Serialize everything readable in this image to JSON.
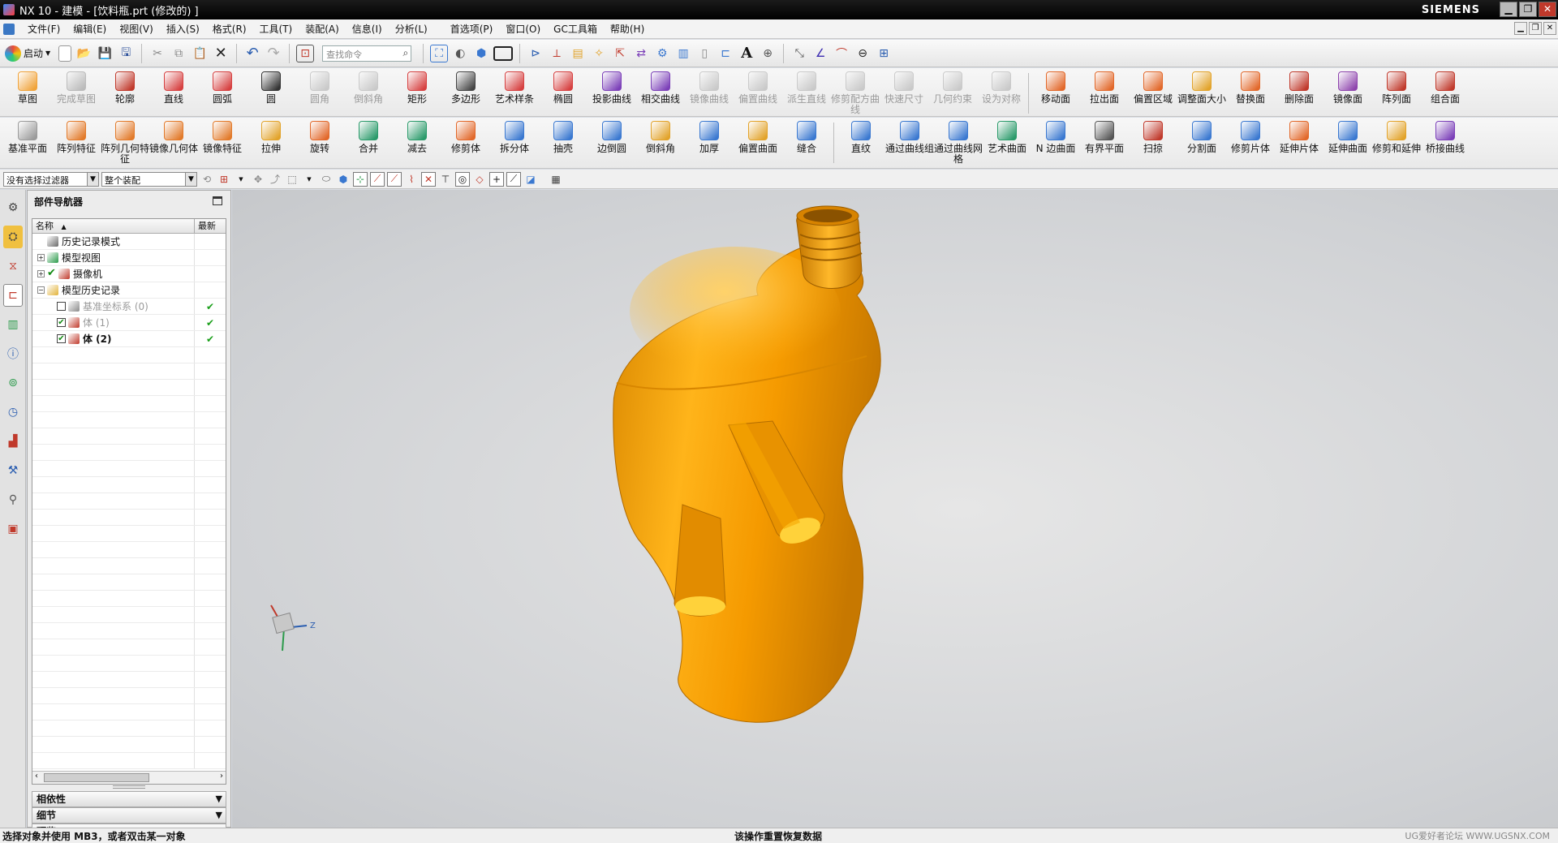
{
  "window": {
    "title": "NX 10 - 建模 - [饮料瓶.prt  (修改的) ]",
    "brand": "SIEMENS",
    "buttons": {
      "minimize": "▁",
      "restore": "❐",
      "close": "✕"
    }
  },
  "menu": [
    "文件(F)",
    "编辑(E)",
    "视图(V)",
    "插入(S)",
    "格式(R)",
    "工具(T)",
    "装配(A)",
    "信息(I)",
    "分析(L)",
    "首选项(P)",
    "窗口(O)",
    "GC工具箱",
    "帮助(H)"
  ],
  "toolbar": {
    "start_label": "启动",
    "search_placeholder": "查找命令"
  },
  "ribbon1": [
    {
      "label": "草图",
      "color": "#f0a33a",
      "disabled": false
    },
    {
      "label": "完成草图",
      "color": "#7a7a7a",
      "disabled": true
    },
    {
      "label": "轮廓",
      "color": "#c0392b",
      "disabled": false
    },
    {
      "label": "直线",
      "color": "#d64040",
      "disabled": false
    },
    {
      "label": "圆弧",
      "color": "#d64040",
      "disabled": false
    },
    {
      "label": "圆",
      "color": "#333333",
      "disabled": false
    },
    {
      "label": "圆角",
      "color": "#9a9a9a",
      "disabled": true
    },
    {
      "label": "倒斜角",
      "color": "#9a9a9a",
      "disabled": true
    },
    {
      "label": "矩形",
      "color": "#d64040",
      "disabled": false
    },
    {
      "label": "多边形",
      "color": "#444444",
      "disabled": false
    },
    {
      "label": "艺术样条",
      "color": "#d64040",
      "disabled": false
    },
    {
      "label": "椭圆",
      "color": "#d64040",
      "disabled": false
    },
    {
      "label": "投影曲线",
      "color": "#7b3fb8",
      "disabled": false
    },
    {
      "label": "相交曲线",
      "color": "#7b3fb8",
      "disabled": false
    },
    {
      "label": "镜像曲线",
      "color": "#9a9a9a",
      "disabled": true
    },
    {
      "label": "偏置曲线",
      "color": "#9a9a9a",
      "disabled": true
    },
    {
      "label": "派生直线",
      "color": "#9a9a9a",
      "disabled": true
    },
    {
      "label": "修剪配方曲线",
      "color": "#9a9a9a",
      "disabled": true
    },
    {
      "label": "快速尺寸",
      "color": "#9a9a9a",
      "disabled": true
    },
    {
      "label": "几何约束",
      "color": "#9a9a9a",
      "disabled": true
    },
    {
      "label": "设为对称",
      "color": "#9a9a9a",
      "disabled": true
    },
    {
      "label": "移动面",
      "color": "#e2682a",
      "disabled": false
    },
    {
      "label": "拉出面",
      "color": "#e2682a",
      "disabled": false
    },
    {
      "label": "偏置区域",
      "color": "#e2682a",
      "disabled": false
    },
    {
      "label": "调整面大小",
      "color": "#e2a32a",
      "disabled": false
    },
    {
      "label": "替换面",
      "color": "#e2682a",
      "disabled": false
    },
    {
      "label": "删除面",
      "color": "#c0392b",
      "disabled": false
    },
    {
      "label": "镜像面",
      "color": "#8e44ad",
      "disabled": false
    },
    {
      "label": "阵列面",
      "color": "#c0392b",
      "disabled": false
    },
    {
      "label": "组合面",
      "color": "#c0392b",
      "disabled": false
    }
  ],
  "ribbon2": [
    {
      "label": "基准平面",
      "color": "#9a9a9a"
    },
    {
      "label": "阵列特征",
      "color": "#e27a2a"
    },
    {
      "label": "阵列几何特征",
      "color": "#e27a2a"
    },
    {
      "label": "镜像几何体",
      "color": "#e27a2a"
    },
    {
      "label": "镜像特征",
      "color": "#e27a2a"
    },
    {
      "label": "拉伸",
      "color": "#e2a32a"
    },
    {
      "label": "旋转",
      "color": "#e2682a"
    },
    {
      "label": "合并",
      "color": "#2a9a6a"
    },
    {
      "label": "减去",
      "color": "#2a9a6a"
    },
    {
      "label": "修剪体",
      "color": "#e2682a"
    },
    {
      "label": "拆分体",
      "color": "#3a78d0"
    },
    {
      "label": "抽壳",
      "color": "#3a78d0"
    },
    {
      "label": "边倒圆",
      "color": "#3a78d0"
    },
    {
      "label": "倒斜角",
      "color": "#e2a32a"
    },
    {
      "label": "加厚",
      "color": "#3a78d0"
    },
    {
      "label": "偏置曲面",
      "color": "#e2a32a"
    },
    {
      "label": "缝合",
      "color": "#3a78d0"
    },
    {
      "label": "直纹",
      "color": "#3a78d0"
    },
    {
      "label": "通过曲线组",
      "color": "#3a78d0"
    },
    {
      "label": "通过曲线网格",
      "color": "#3a78d0"
    },
    {
      "label": "艺术曲面",
      "color": "#2a9a6a"
    },
    {
      "label": "N 边曲面",
      "color": "#3a78d0"
    },
    {
      "label": "有界平面",
      "color": "#555555"
    },
    {
      "label": "扫掠",
      "color": "#c0392b"
    },
    {
      "label": "分割面",
      "color": "#3a78d0"
    },
    {
      "label": "修剪片体",
      "color": "#3a78d0"
    },
    {
      "label": "延伸片体",
      "color": "#e2682a"
    },
    {
      "label": "延伸曲面",
      "color": "#3a78d0"
    },
    {
      "label": "修剪和延伸",
      "color": "#e2a32a"
    },
    {
      "label": "桥接曲线",
      "color": "#7b3fb8"
    }
  ],
  "filterbar": {
    "filter_value": "没有选择过滤器",
    "scope_value": "整个装配"
  },
  "navigator": {
    "title": "部件导航器",
    "col_name": "名称",
    "col_latest": "最新",
    "rows": [
      {
        "label": "历史记录模式",
        "indent": 1,
        "expander": "",
        "check": "",
        "icon_color": "#6a6a6a",
        "latest": "",
        "style": ""
      },
      {
        "label": "模型视图",
        "indent": 0,
        "expander": "+",
        "check": "",
        "icon_color": "#2a9a4a",
        "latest": "",
        "style": ""
      },
      {
        "label": "摄像机",
        "indent": 0,
        "expander": "+",
        "check": "✔",
        "icon_color": "#c0392b",
        "latest": "",
        "style": ""
      },
      {
        "label": "模型历史记录",
        "indent": 0,
        "expander": "−",
        "check": "",
        "icon_color": "#e2b33a",
        "latest": "",
        "style": ""
      },
      {
        "label": "基准坐标系 (0)",
        "indent": 2,
        "expander": "",
        "check": "☐",
        "icon_color": "#8a8a8a",
        "latest": "✔",
        "style": "dim"
      },
      {
        "label": "体 (1)",
        "indent": 2,
        "expander": "",
        "check": "✔",
        "icon_color": "#c0392b",
        "latest": "✔",
        "style": "dim"
      },
      {
        "label": "体 (2)",
        "indent": 2,
        "expander": "",
        "check": "✔",
        "icon_color": "#c0392b",
        "latest": "✔",
        "style": "bold"
      }
    ],
    "sections": [
      "相依性",
      "细节",
      "预览"
    ]
  },
  "status": {
    "left": "选择对象并使用 MB3，或者双击某一对象",
    "center": "该操作重置恢复数据",
    "watermark": "UG爱好者论坛 WWW.UGSNX.COM"
  },
  "colors": {
    "bottle": "#f5a000",
    "bottle_dark": "#c47a00",
    "viewport_bg": "#d3d5d8"
  }
}
